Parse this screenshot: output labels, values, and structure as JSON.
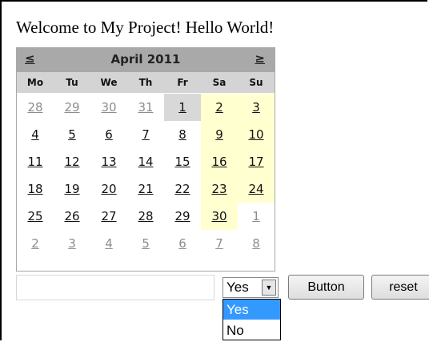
{
  "heading": "Welcome to My Project! Hello World!",
  "calendar": {
    "prev": "≤",
    "next": "≥",
    "month_title": "April 2011",
    "days_of_week": [
      "Mo",
      "Tu",
      "We",
      "Th",
      "Fr",
      "Sa",
      "Su"
    ],
    "weeks": [
      [
        "28",
        "29",
        "30",
        "31",
        "1",
        "2",
        "3"
      ],
      [
        "4",
        "5",
        "6",
        "7",
        "8",
        "9",
        "10"
      ],
      [
        "11",
        "12",
        "13",
        "14",
        "15",
        "16",
        "17"
      ],
      [
        "18",
        "19",
        "20",
        "21",
        "22",
        "23",
        "24"
      ],
      [
        "25",
        "26",
        "27",
        "28",
        "29",
        "30",
        "1"
      ],
      [
        "2",
        "3",
        "4",
        "5",
        "6",
        "7",
        "8"
      ]
    ],
    "selected_day": "1",
    "colors": {
      "header_bg": "#a9a9a9",
      "dow_bg": "#d4d4d4",
      "weekend_bg": "#ffffd0",
      "selected_bg": "#d8d8d8",
      "other_month_text": "#8c8c8c"
    }
  },
  "form": {
    "text_value": "",
    "select_value": "Yes",
    "select_options": [
      "Yes",
      "No"
    ],
    "highlighted_option": "Yes",
    "button_label": "Button",
    "reset_label": "reset",
    "highlight_color": "#3399ff"
  }
}
